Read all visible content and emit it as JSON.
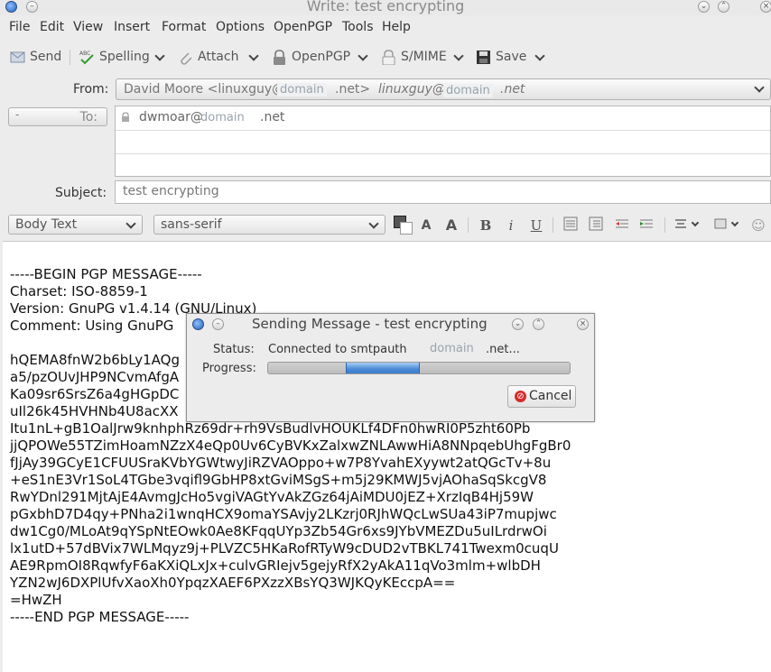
{
  "window": {
    "title": "Write: test encrypting"
  },
  "menu": [
    "File",
    "Edit",
    "View",
    "Insert",
    "Format",
    "Options",
    "OpenPGP",
    "Tools",
    "Help"
  ],
  "toolbar": {
    "send": "Send",
    "spelling": "Spelling",
    "attach": "Attach",
    "openpgp": "OpenPGP",
    "smime": "S/MIME",
    "save": "Save"
  },
  "header": {
    "from_label": "From:",
    "from_name": "David Moore <linuxguy@",
    "from_domain_redacted": "domain",
    "from_suffix": ".net>",
    "from_identity": "linuxguy@",
    "from_identity_domain": "domain",
    "from_identity_suffix": ".net",
    "to_label": "To:",
    "to_button": "-",
    "to_user": "dwmoar@",
    "to_domain": "domain",
    "to_suffix": ".net",
    "subject_label": "Subject:",
    "subject_value": "test encrypting"
  },
  "format": {
    "paragraph_style": "Body Text",
    "font_family": "sans-serif"
  },
  "body_lines": [
    "-----BEGIN PGP MESSAGE-----",
    "Charset: ISO-8859-1",
    "Version: GnuPG v1.4.14 (GNU/Linux)",
    "Comment: Using GnuPG",
    "",
    "hQEMA8fnW2b6bLy1AQg",
    "a5/pzOUvJHP9NCvmAfgA",
    "Ka09sr6SrsZ6a4gHGpDC",
    "uIl26k45HVHNb4U8acXX",
    "Itu1nL+gB1OalJrw9knhphRz69dr+rh9VsBudlvHOUKLf4DFn0hwRI0P5zht60Pb",
    "jjQPOWe55TZimHoamNZzX4eQp0Uv6CyBVKxZalxwZNLAwwHiA8NNpqebUhgFgBr0",
    "fJjAy39GCyE1CFUUSraKVbYGWtwyJiRZVAOppo+w7P8YvahEXyywt2atQGcTv+8u",
    "+eS1nE3Vr1SoL4TGbe3vqifl9GbHP8xtGviMSgS+m5j29KMWJ5vjAOhaSqSkcgV8",
    "RwYDnl291MjtAjE4AvmgJcHo5vgiVAGtYvAkZGz64jAiMDU0jEZ+XrzIqB4Hj59W",
    "pGxbhD7D4qy+PNha2i1wnqHCX9omaYSAvjy2LKzrj0RJhWQcLwSUa43iP7mupjwc",
    "dw1Cg0/MLoAt9qYSpNtEOwk0Ae8KFqqUYp3Zb54Gr6xs9JYbVMEZDu5uILrdrwOi",
    "lx1utD+57dBVix7WLMqyz9j+PLVZC5HKaRofRTyW9cDUD2vTBKL741Twexm0cuqU",
    "AE9RpmOI8RqwfyF6aKXiQLxJx+culvGRIejv5gejyRfX2yAkA11qVo3mlm+wlbDH",
    "YZN2wJ6DXPlUfvXaoXh0YpqzXAEF6PXzzXBsYQ3WJKQyKEccpA==",
    "=HwZH",
    "-----END PGP MESSAGE-----"
  ],
  "dialog": {
    "title": "Sending Message - test encrypting",
    "status_label": "Status:",
    "status_value": "Connected to smtpauth",
    "status_domain": "domain",
    "status_suffix": ".net...",
    "progress_label": "Progress:",
    "progress_indeterminate": true,
    "cancel": "Cancel"
  },
  "colors": {
    "progress": "#4a8ad6",
    "cancel_icon": "#d62b2b",
    "app_icon": "#1f5fb8"
  }
}
